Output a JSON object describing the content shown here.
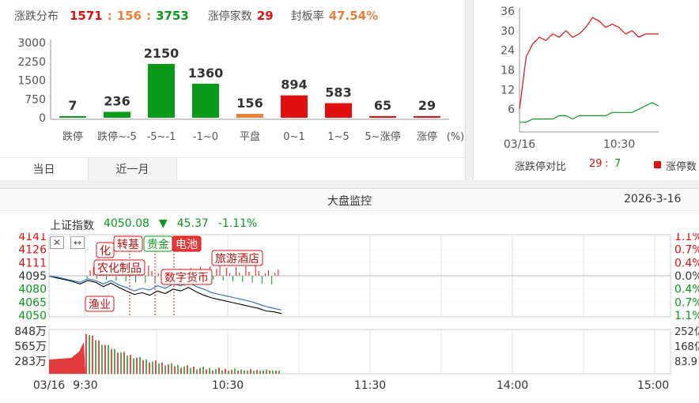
{
  "distribution": {
    "title": "涨跌分布",
    "up": "1571",
    "sep1": ":",
    "flat": "156",
    "sep2": ":",
    "down": "3753",
    "limit_up_label": "涨停家数",
    "limit_up_count": "29",
    "seal_label": "封板率",
    "seal_rate": "47.54%",
    "percent_unit": "(%)"
  },
  "tabs": [
    {
      "label": "当日",
      "active": true
    },
    {
      "label": "近一月",
      "active": false
    }
  ],
  "ratio": {
    "footer_label": "涨跌停对比",
    "up": "29",
    "sep": ":",
    "down": "7",
    "legend_label": "涨停数"
  },
  "monitor": {
    "title": "大盘监控",
    "date": "2026-3-16",
    "index_name": "上证指数",
    "index_value": "4050.08",
    "change": "45.37",
    "change_pct": "-1.11%",
    "btn_close": "✕",
    "btn_resize": "↔",
    "tags": [
      "转基",
      "化",
      "贵金",
      "电池",
      "农化制品",
      "旅游酒店",
      "数字货币",
      "渔业"
    ],
    "volume_date": "03/16"
  },
  "chart_data": [
    {
      "type": "bar",
      "title": "",
      "categories": [
        "跌停",
        "跌停~-5",
        "-5~-1",
        "-1~0",
        "平盘",
        "0~1",
        "1~5",
        "5~涨停",
        "涨停"
      ],
      "values": [
        7,
        236,
        2150,
        1360,
        156,
        894,
        583,
        65,
        29
      ],
      "colors": [
        "#0a9a1a",
        "#0a9a1a",
        "#0a9a1a",
        "#0a9a1a",
        "#e8803a",
        "#e01010",
        "#e01010",
        "#e01010",
        "#e01010"
      ],
      "yticks": [
        0,
        750,
        1500,
        2250,
        3000
      ],
      "ylim": [
        0,
        3000
      ]
    },
    {
      "type": "line",
      "title": "",
      "x_labels": [
        "03/16",
        "10:30"
      ],
      "yticks": [
        6,
        12,
        18,
        24,
        30,
        36
      ],
      "ylim": [
        0,
        36
      ],
      "series": [
        {
          "name": "涨停数",
          "color": "#e01010",
          "values": [
            6,
            22,
            26,
            28,
            27,
            29,
            28,
            30,
            28,
            29,
            31,
            34,
            33,
            31,
            32,
            31,
            29,
            30,
            28,
            29,
            29,
            29
          ]
        },
        {
          "color": "#0a9a1a",
          "values": [
            2,
            2,
            3,
            3,
            3,
            3,
            4,
            4,
            3,
            4,
            4,
            4,
            4,
            4,
            5,
            5,
            5,
            5,
            6,
            7,
            8,
            7
          ]
        }
      ]
    },
    {
      "type": "line",
      "title": "",
      "x_labels": [
        "03/16",
        "9:30",
        "10:30",
        "11:30",
        "14:00",
        "15:00"
      ],
      "left_ticks": [
        "4141",
        "4126",
        "4111",
        "4095",
        "4080",
        "4065",
        "4050"
      ],
      "right_ticks": [
        "1.1%",
        "0.7%",
        "0.4%",
        "0.0%",
        "0.4%",
        "0.7%",
        "1.1%"
      ],
      "volume_ticks": [
        "848万",
        "565万",
        "283万"
      ],
      "right_volume_ticks": [
        "252亿",
        "168亿",
        "83.9"
      ],
      "ylim": [
        4050,
        4141
      ],
      "series": [
        {
          "color": "#000000",
          "values": [
            4095,
            4093,
            4091,
            4089,
            4086,
            4090,
            4088,
            4083,
            4087,
            4082,
            4078,
            4074,
            4076,
            4073,
            4078,
            4075,
            4080,
            4078,
            4082,
            4077,
            4073,
            4070,
            4068,
            4066,
            4064,
            4062,
            4060,
            4058,
            4055,
            4054,
            4052
          ]
        },
        {
          "color": "#1d6fc9",
          "values": [
            4095,
            4094,
            4092,
            4090,
            4088,
            4092,
            4090,
            4086,
            4090,
            4085,
            4082,
            4078,
            4081,
            4079,
            4084,
            4081,
            4086,
            4084,
            4088,
            4083,
            4080,
            4076,
            4074,
            4072,
            4070,
            4068,
            4066,
            4063,
            4060,
            4058,
            4056
          ]
        }
      ]
    }
  ]
}
